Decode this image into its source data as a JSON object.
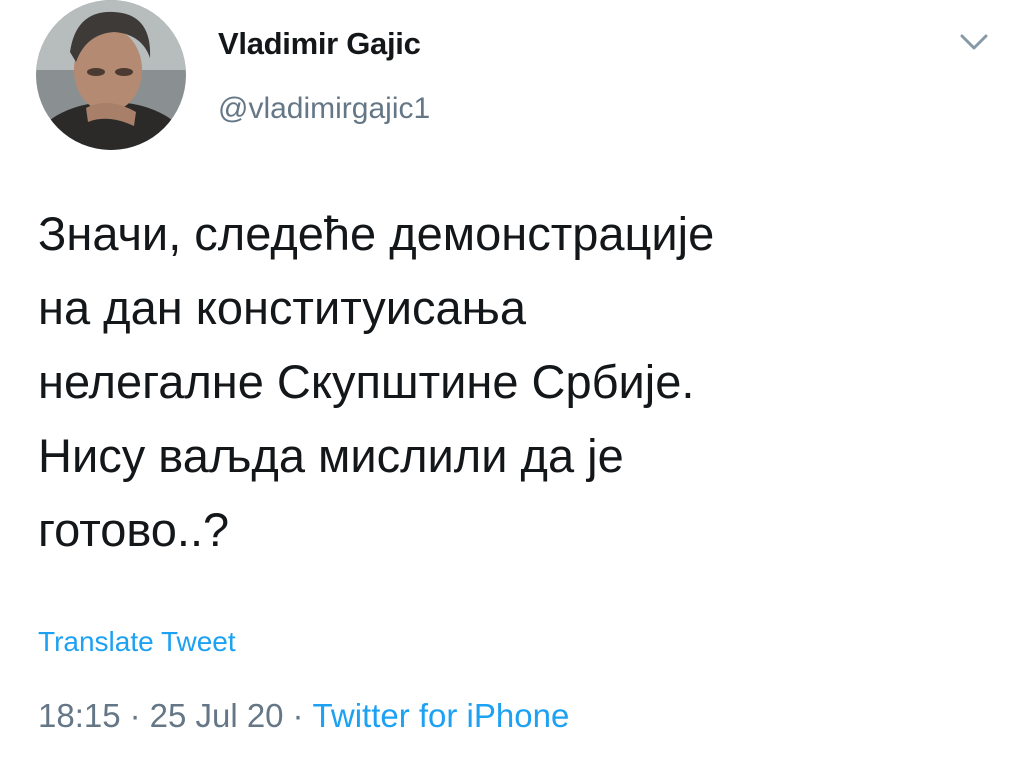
{
  "tweet": {
    "author": {
      "display_name": "Vladimir Gajic",
      "handle": "@vladimirgajic1",
      "avatar_icon": "profile-photo"
    },
    "menu_icon": "chevron-down-icon",
    "text_lines": [
      "Значи, следеће демонстрације",
      "на дан конституисања",
      "нелегалне Скупштине Србије.",
      "Нису ваљда мислили да је",
      "готово..?"
    ],
    "translate_label": "Translate Tweet",
    "time": "18:15",
    "date": "25 Jul 20",
    "separator": "·",
    "source": "Twitter for iPhone"
  },
  "colors": {
    "text": "#14171a",
    "secondary": "#657786",
    "accent": "#1da1f2",
    "background": "#ffffff"
  }
}
